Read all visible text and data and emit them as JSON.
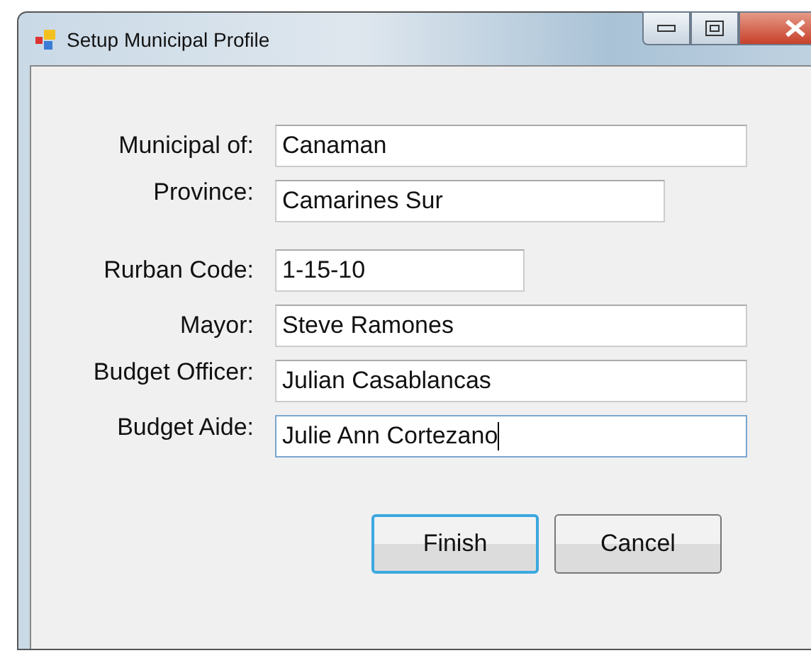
{
  "window": {
    "title": "Setup Municipal Profile"
  },
  "fields": [
    {
      "label": "Municipal of:",
      "value": "Canaman",
      "focused": false
    },
    {
      "label": "Province:",
      "value": "Camarines Sur",
      "focused": false
    },
    {
      "label": "Rurban Code:",
      "value": "1-15-10",
      "focused": false
    },
    {
      "label": "Mayor:",
      "value": "Steve Ramones",
      "focused": false
    },
    {
      "label": "Budget Officer:",
      "value": "Julian Casablancas",
      "focused": false
    },
    {
      "label": "Budget Aide:",
      "value": "Julie Ann Cortezano",
      "focused": true
    }
  ],
  "buttons": [
    {
      "label": "Finish",
      "default": true
    },
    {
      "label": "Cancel",
      "default": false
    }
  ]
}
